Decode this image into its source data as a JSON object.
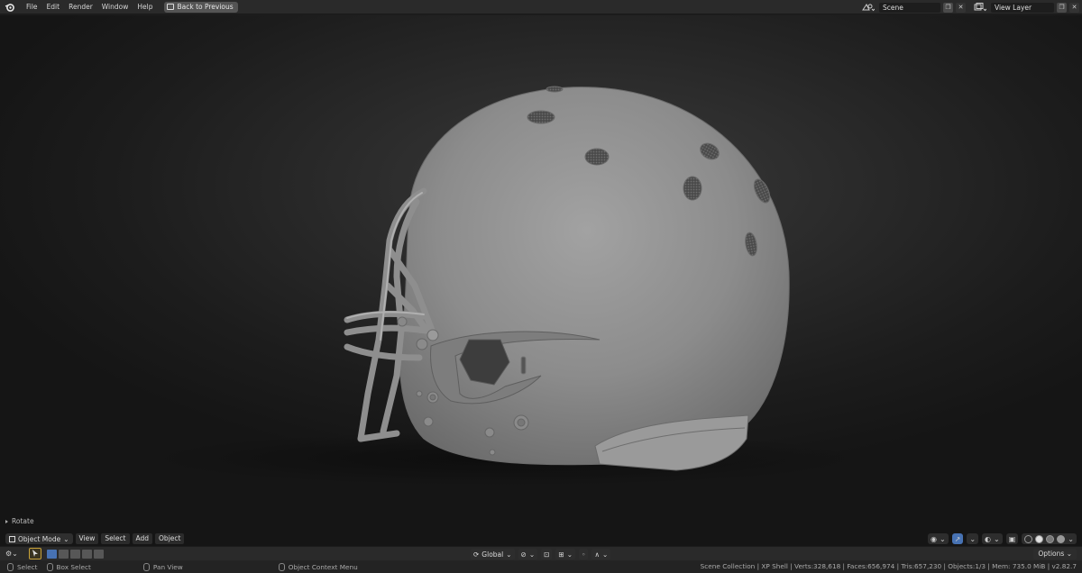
{
  "menus": [
    "File",
    "Edit",
    "Render",
    "Window",
    "Help"
  ],
  "back_button": "Back to Previous",
  "scene": {
    "label": "Scene"
  },
  "view_layer": {
    "label": "View Layer"
  },
  "operator_panel": {
    "label": "Rotate"
  },
  "viewport_header": {
    "mode": "Object Mode",
    "menus": [
      "View",
      "Select",
      "Add",
      "Object"
    ]
  },
  "tool_header": {
    "orientation": "Global",
    "options": "Options"
  },
  "statusbar": {
    "select": "Select",
    "box_select": "Box Select",
    "pan_view": "Pan View",
    "context_menu": "Object Context Menu",
    "stats": "Scene Collection | XP Shell | Verts:328,618 | Faces:656,974 | Tris:657,230 | Objects:1/3 | Mem: 735.0 MiB | v2.82.7"
  },
  "colors": {
    "accent_blue": "#4772b3",
    "active_tool": "#c9a33a",
    "helmet": "#8f8f8f"
  }
}
